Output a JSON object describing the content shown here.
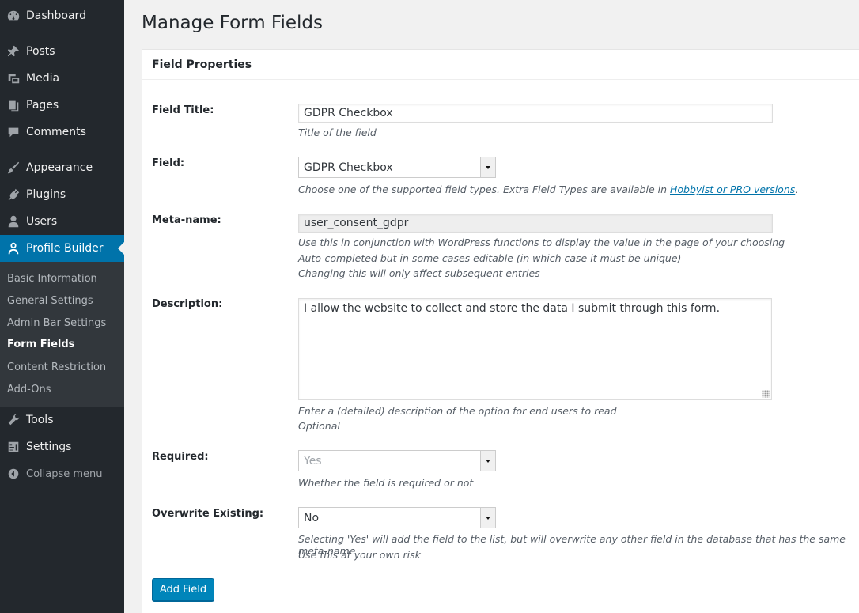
{
  "sidebar": {
    "menu": [
      {
        "label": "Dashboard",
        "icon": "dashboard-icon"
      },
      {
        "label": "Posts",
        "icon": "pin-icon"
      },
      {
        "label": "Media",
        "icon": "media-icon"
      },
      {
        "label": "Pages",
        "icon": "pages-icon"
      },
      {
        "label": "Comments",
        "icon": "comment-icon"
      },
      {
        "label": "Appearance",
        "icon": "brush-icon"
      },
      {
        "label": "Plugins",
        "icon": "plug-icon"
      },
      {
        "label": "Users",
        "icon": "user-icon"
      },
      {
        "label": "Profile Builder",
        "icon": "profile-icon"
      },
      {
        "label": "Tools",
        "icon": "wrench-icon"
      },
      {
        "label": "Settings",
        "icon": "settings-icon"
      }
    ],
    "submenu": [
      "Basic Information",
      "General Settings",
      "Admin Bar Settings",
      "Form Fields",
      "Content Restriction",
      "Add-Ons"
    ],
    "collapse": "Collapse menu"
  },
  "page_title": "Manage Form Fields",
  "panel_title": "Field Properties",
  "fields": {
    "title": {
      "label": "Field Title:",
      "value": "GDPR Checkbox",
      "help": "Title of the field"
    },
    "field": {
      "label": "Field:",
      "value": "GDPR Checkbox",
      "help_prefix": "Choose one of the supported field types. Extra Field Types are available in ",
      "help_link": "Hobbyist or PRO versions",
      "help_suffix": "."
    },
    "meta": {
      "label": "Meta-name:",
      "value": "user_consent_gdpr",
      "help1": "Use this in conjunction with WordPress functions to display the value in the page of your choosing",
      "help2": "Auto-completed but in some cases editable (in which case it must be unique)",
      "help3": "Changing this will only affect subsequent entries"
    },
    "description": {
      "label": "Description:",
      "value": "I allow the website to collect and store the data I submit through this form.",
      "help1": "Enter a (detailed) description of the option for end users to read",
      "help2": "Optional"
    },
    "required": {
      "label": "Required:",
      "value": "Yes",
      "help": "Whether the field is required or not"
    },
    "overwrite": {
      "label": "Overwrite Existing:",
      "value": "No",
      "help1": "Selecting 'Yes' will add the field to the list, but will overwrite any other field in the database that has the same meta-name",
      "help2": "Use this at your own risk"
    }
  },
  "add_button": "Add Field",
  "colors": {
    "sidebar": "#23282d",
    "submenu": "#32373c",
    "accent": "#0073aa",
    "button": "#0085ba"
  }
}
